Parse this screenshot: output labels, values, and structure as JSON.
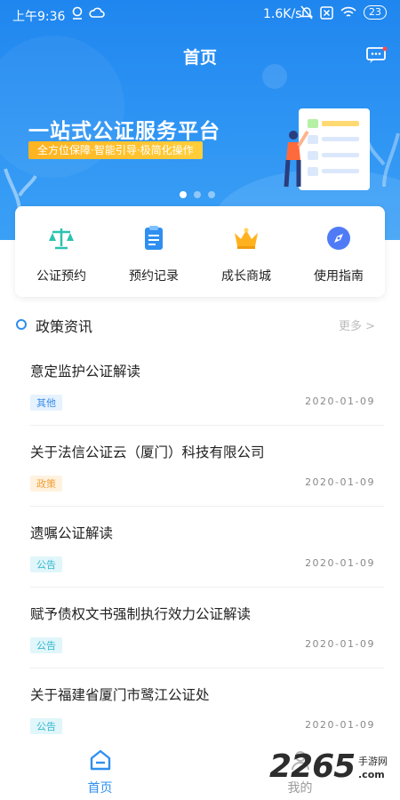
{
  "status_bar": {
    "time": "上午9:36",
    "net_speed": "1.6K/s",
    "battery": "23"
  },
  "header": {
    "title": "首页",
    "message_icon": "chat-bubble-icon"
  },
  "banner": {
    "headline": "一站式公证服务平台",
    "subline": "全方位保障·智能引导·极简化操作",
    "slide_count": 3,
    "active_slide": 1
  },
  "quick_menu": [
    {
      "label": "公证预约",
      "icon": "balance-scale-icon",
      "color": "#2cc2b0"
    },
    {
      "label": "预约记录",
      "icon": "clipboard-list-icon",
      "color": "#2f8ff0"
    },
    {
      "label": "成长商城",
      "icon": "crown-icon",
      "color": "#ffb21e"
    },
    {
      "label": "使用指南",
      "icon": "compass-icon",
      "color": "#4f7cf6"
    }
  ],
  "policy_section": {
    "title": "政策资讯",
    "more_label": "更多 >"
  },
  "news": [
    {
      "title": "意定监护公证解读",
      "tag": "其他",
      "date": "2020-01-09"
    },
    {
      "title": "关于法信公证云（厦门）科技有限公司",
      "tag": "政策",
      "date": "2020-01-09"
    },
    {
      "title": "遗嘱公证解读",
      "tag": "公告",
      "date": "2020-01-09"
    },
    {
      "title": "赋予债权文书强制执行效力公证解读",
      "tag": "公告",
      "date": "2020-01-09"
    },
    {
      "title": "关于福建省厦门市鹭江公证处",
      "tag": "公告",
      "date": "2020-01-09"
    }
  ],
  "bottom_nav": [
    {
      "label": "首页",
      "icon": "home-icon",
      "active": true
    },
    {
      "label": "我的",
      "icon": "user-icon",
      "active": false
    }
  ],
  "watermark": {
    "number": "2265",
    "cn": "手游网",
    "url": ".com"
  },
  "colors": {
    "primary": "#2f8ff0",
    "hero_top": "#1f86ef"
  }
}
